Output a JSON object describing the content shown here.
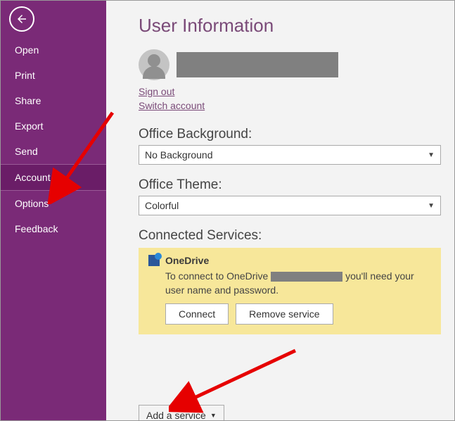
{
  "sidebar": {
    "items": [
      {
        "label": "Open"
      },
      {
        "label": "Print"
      },
      {
        "label": "Share"
      },
      {
        "label": "Export"
      },
      {
        "label": "Send"
      },
      {
        "label": "Account"
      },
      {
        "label": "Options"
      },
      {
        "label": "Feedback"
      }
    ],
    "selected_index": 5
  },
  "page": {
    "title": "User Information",
    "sign_out": "Sign out",
    "switch_account": "Switch account"
  },
  "background": {
    "label": "Office Background:",
    "value": "No Background"
  },
  "theme": {
    "label": "Office Theme:",
    "value": "Colorful"
  },
  "services": {
    "label": "Connected Services:",
    "onedrive": {
      "title": "OneDrive",
      "desc_prefix": "To connect to OneDrive",
      "desc_suffix": "you'll need your user name and password.",
      "connect": "Connect",
      "remove": "Remove service"
    }
  },
  "add_service": "Add a service"
}
